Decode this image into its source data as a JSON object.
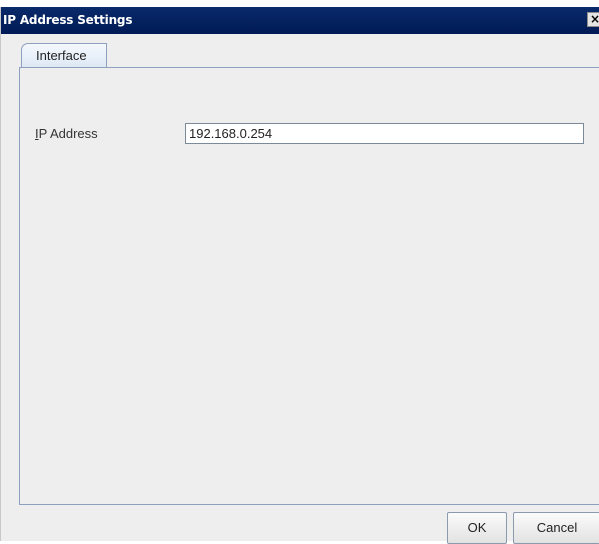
{
  "window": {
    "title": "IP Address Settings",
    "close_glyph": "✕"
  },
  "tabs": [
    {
      "label": "Interface",
      "selected": true
    }
  ],
  "form": {
    "ip_label_mnemonic": "I",
    "ip_label_rest": "P Address",
    "ip_value": "192.168.0.254"
  },
  "buttons": {
    "ok_label": "OK",
    "cancel_label": "Cancel"
  },
  "colors": {
    "titlebar": "#001a55",
    "tab_border": "#8ea0bd",
    "background": "#eeeeee"
  }
}
